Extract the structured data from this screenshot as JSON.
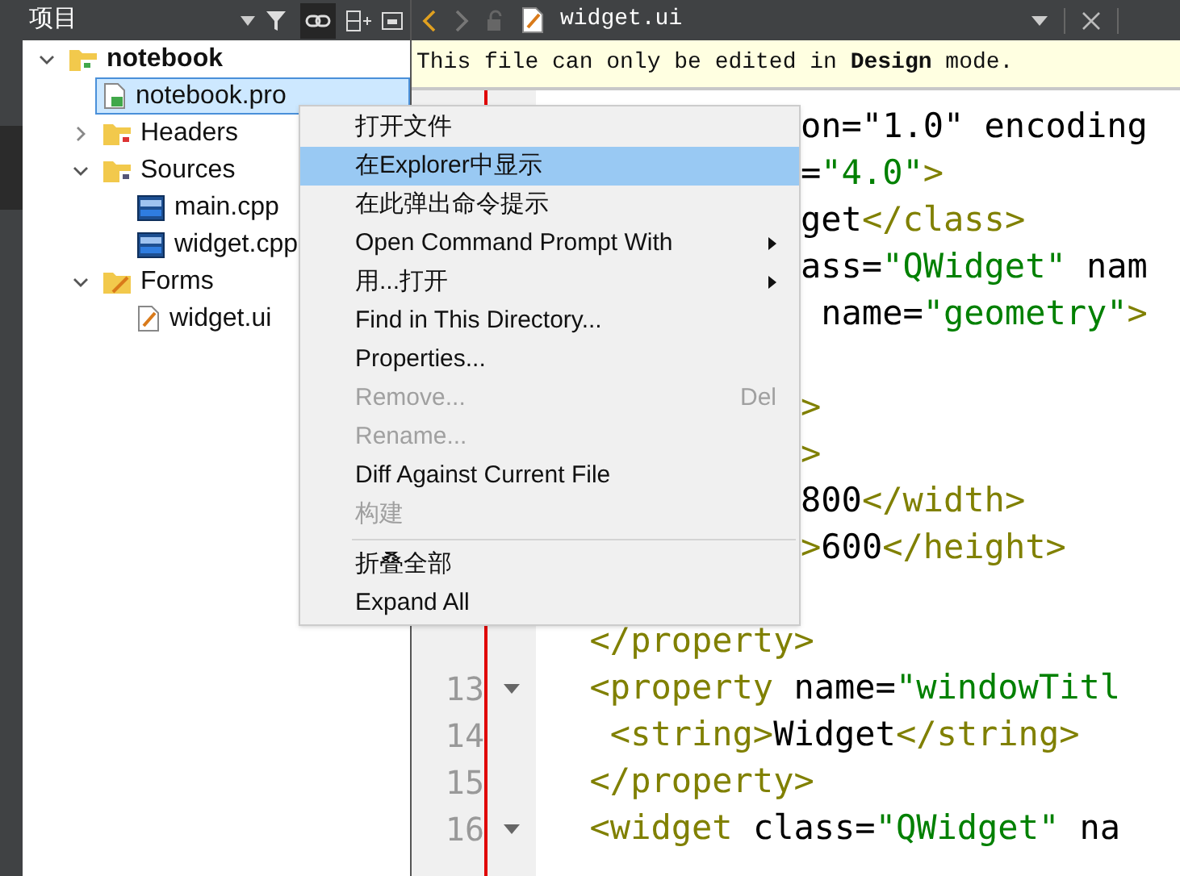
{
  "sidebar": {
    "title": "项目",
    "tree": [
      {
        "label": "notebook",
        "kind": "project",
        "bold": true,
        "expanded": true,
        "selected": false,
        "children": [
          {
            "label": "notebook.pro",
            "kind": "pro",
            "bold": false,
            "selected": true
          },
          {
            "label": "Headers",
            "kind": "headers",
            "bold": false,
            "expanded": false,
            "selected": false
          },
          {
            "label": "Sources",
            "kind": "sources",
            "bold": false,
            "expanded": true,
            "selected": false,
            "children": [
              {
                "label": "main.cpp",
                "kind": "cpp",
                "bold": false,
                "selected": false
              },
              {
                "label": "widget.cpp",
                "kind": "cpp",
                "bold": false,
                "selected": false
              }
            ]
          },
          {
            "label": "Forms",
            "kind": "forms",
            "bold": false,
            "expanded": true,
            "selected": false,
            "children": [
              {
                "label": "widget.ui",
                "kind": "ui",
                "bold": false,
                "selected": false
              }
            ]
          }
        ]
      }
    ]
  },
  "editor": {
    "file_name": "widget.ui",
    "info_bar": "This file can only be edited in **Design** mode.",
    "lines": [
      {
        "kind": "covered",
        "tokens": [
          {
            "kind": "text",
            "s": "on=\"1.0\" encoding"
          }
        ]
      },
      {
        "kind": "covered",
        "tokens": [
          {
            "kind": "text",
            "s": "="
          },
          {
            "kind": "string",
            "s": "\"4.0\""
          },
          {
            "kind": "tag",
            "s": ">"
          }
        ]
      },
      {
        "kind": "covered",
        "tokens": [
          {
            "kind": "text",
            "s": "get"
          },
          {
            "kind": "tag",
            "s": "</class>"
          }
        ]
      },
      {
        "kind": "covered",
        "tokens": [
          {
            "kind": "text",
            "s": "ass="
          },
          {
            "kind": "string",
            "s": "\"QWidget\""
          },
          {
            "kind": "text",
            "s": " nam"
          }
        ]
      },
      {
        "kind": "covered",
        "tokens": [
          {
            "kind": "text",
            "s": " name="
          },
          {
            "kind": "string",
            "s": "\"geometry\""
          },
          {
            "kind": "tag",
            "s": ">"
          }
        ]
      },
      {
        "kind": "covered"
      },
      {
        "kind": "covered",
        "tokens": [
          {
            "kind": "tag",
            "s": ">"
          }
        ]
      },
      {
        "kind": "covered",
        "tokens": [
          {
            "kind": "tag",
            "s": ">"
          }
        ]
      },
      {
        "kind": "covered",
        "tokens": [
          {
            "kind": "text",
            "s": "800"
          },
          {
            "kind": "tag",
            "s": "</width>"
          }
        ]
      },
      {
        "kind": "covered",
        "tokens": [
          {
            "kind": "tag",
            "s": ">"
          },
          {
            "kind": "text",
            "s": "600"
          },
          {
            "kind": "tag",
            "s": "</height>"
          }
        ]
      },
      {
        "kind": "covered"
      },
      {
        "kind": "full",
        "fold": false,
        "tokens": [
          {
            "kind": "tag",
            "s": "  </property>"
          }
        ]
      },
      {
        "kind": "full",
        "number": "13",
        "fold": true,
        "tokens": [
          {
            "kind": "tag",
            "s": "  <property"
          },
          {
            "kind": "text",
            "s": " name="
          },
          {
            "kind": "string",
            "s": "\"windowTitl"
          }
        ]
      },
      {
        "kind": "full",
        "number": "14",
        "fold": false,
        "tokens": [
          {
            "kind": "tag",
            "s": "   <string>"
          },
          {
            "kind": "text",
            "s": "Widget"
          },
          {
            "kind": "tag",
            "s": "</string>"
          }
        ]
      },
      {
        "kind": "full",
        "number": "15",
        "fold": false,
        "tokens": [
          {
            "kind": "tag",
            "s": "  </property>"
          }
        ]
      },
      {
        "kind": "full",
        "number": "16",
        "fold": true,
        "tokens": [
          {
            "kind": "tag",
            "s": "  <widget"
          },
          {
            "kind": "text",
            "s": " class="
          },
          {
            "kind": "string",
            "s": "\"QWidget\""
          },
          {
            "kind": "text",
            "s": " na"
          }
        ]
      }
    ]
  },
  "context_menu": [
    {
      "kind": "item",
      "label": "打开文件",
      "selected": false,
      "disabled": false
    },
    {
      "kind": "item",
      "label": "在Explorer中显示",
      "selected": true,
      "disabled": false
    },
    {
      "kind": "item",
      "label": "在此弹出命令提示",
      "selected": false,
      "disabled": false
    },
    {
      "kind": "submenu",
      "label": "Open Command Prompt With",
      "selected": false,
      "disabled": false
    },
    {
      "kind": "submenu",
      "label": "用...打开",
      "selected": false,
      "disabled": false
    },
    {
      "kind": "item",
      "label": "Find in This Directory...",
      "selected": false,
      "disabled": false
    },
    {
      "kind": "item",
      "label": "Properties...",
      "selected": false,
      "disabled": false
    },
    {
      "kind": "item",
      "label": "Remove...",
      "shortcut": "Del",
      "selected": false,
      "disabled": true
    },
    {
      "kind": "item",
      "label": "Rename...",
      "selected": false,
      "disabled": true
    },
    {
      "kind": "item",
      "label": "Diff Against Current File",
      "selected": false,
      "disabled": false
    },
    {
      "kind": "item",
      "label": "构建",
      "selected": false,
      "disabled": true
    },
    {
      "kind": "separator"
    },
    {
      "kind": "item",
      "label": "折叠全部",
      "selected": false,
      "disabled": false
    },
    {
      "kind": "item",
      "label": "Expand All",
      "selected": false,
      "disabled": false
    }
  ]
}
